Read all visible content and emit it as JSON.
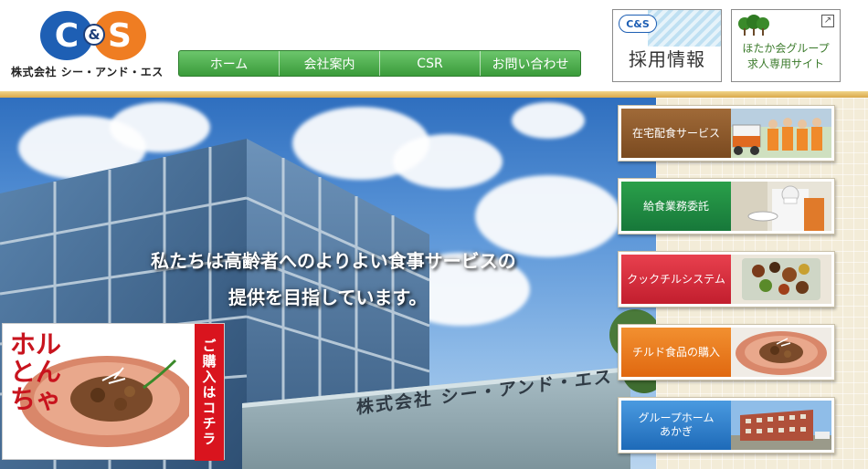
{
  "header": {
    "logo": {
      "letter_left": "C",
      "ampersand": "&",
      "letter_right": "S",
      "company_name": "株式会社 シー・アンド・エス"
    },
    "nav": [
      {
        "label": "ホーム"
      },
      {
        "label": "会社案内"
      },
      {
        "label": "CSR"
      },
      {
        "label": "お問い合わせ"
      }
    ],
    "recruit": {
      "badge": "C&S",
      "label": "採用情報"
    },
    "group_recruit": {
      "line1": "ほたか会グループ",
      "line2": "求人専用サイト",
      "ext_icon": "↗"
    }
  },
  "hero": {
    "tagline_line1": "私たちは高齢者へのよりよい食事サービスの",
    "tagline_line2": "提供を目指しています。",
    "building_sign": "株式会社 シー・アンド・エス",
    "promo": {
      "product_name": "ホルとんちゃ",
      "ribbon": "ご購入はコチラ"
    }
  },
  "services": [
    {
      "label": "在宅配食サービス",
      "color": "#8a5a2b"
    },
    {
      "label": "給食業務委託",
      "color": "#1e8a3c"
    },
    {
      "label": "クックチルシステム",
      "color": "#d22a3a"
    },
    {
      "label": "チルド食品の購入",
      "color": "#e8781e"
    },
    {
      "label": "グループホーム\nあかぎ",
      "color": "#2a7ac8"
    }
  ],
  "colors": {
    "nav_green": "#3a9b3a",
    "logo_blue": "#1e5fb4",
    "logo_orange": "#ef7d22",
    "accent_red": "#d9141e"
  }
}
